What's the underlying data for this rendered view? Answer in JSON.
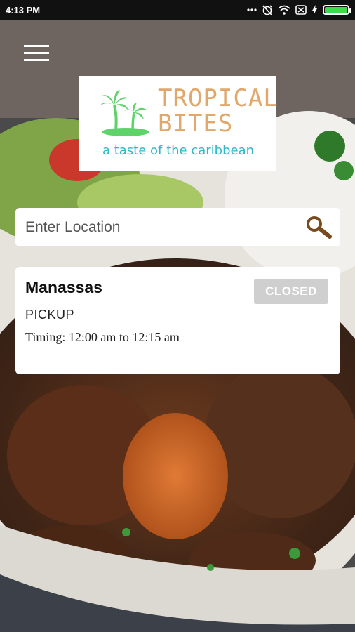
{
  "status_bar": {
    "time": "4:13 PM",
    "icons": [
      "more-dots-icon",
      "alarm-off-icon",
      "wifi-icon",
      "sim-off-icon",
      "charging-icon",
      "battery-icon"
    ],
    "battery_level": 1.0,
    "battery_color": "#3ddc4f"
  },
  "header": {
    "menu_icon": "hamburger-menu-icon"
  },
  "logo": {
    "name_line1": "TROPICAL",
    "name_line2": "BITES",
    "tagline": "a taste of the caribbean",
    "name_color": "#e0a86b",
    "tagline_color": "#33b7c6",
    "palm_color": "#5fd36a"
  },
  "search": {
    "placeholder": "Enter Location",
    "value": "",
    "icon": "search-icon",
    "icon_color": "#7a4a1c"
  },
  "stores": [
    {
      "name": "Manassas",
      "status": "CLOSED",
      "order_type": "PICKUP",
      "timing": "Timing: 12:00 am to 12:15 am"
    }
  ]
}
